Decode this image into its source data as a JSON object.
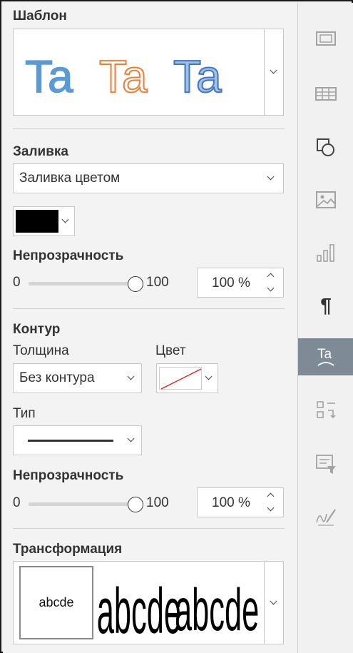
{
  "template": {
    "heading": "Шаблон",
    "samples": [
      {
        "text": "Ta",
        "fill": "#5b9bd5",
        "outline": "#5b9bd5"
      },
      {
        "text": "Ta",
        "fill": "#ffffff",
        "outline": "#ed7d31"
      },
      {
        "text": "Ta",
        "fill": "#9dc3e6",
        "outline": "#4472c4"
      }
    ]
  },
  "fill": {
    "heading": "Заливка",
    "type_value": "Заливка цветом",
    "color": "#000000",
    "opacity_label": "Непрозрачность",
    "min": "0",
    "max": "100",
    "level": 1.0,
    "value": "100 %"
  },
  "contour": {
    "heading": "Контур",
    "thickness_label": "Толщина",
    "thickness_value": "Без контура",
    "color_label": "Цвет",
    "type_label": "Тип",
    "opacity_label": "Непрозрачность",
    "min": "0",
    "max": "100",
    "level": 1.0,
    "value": "100 %"
  },
  "transform": {
    "heading": "Трансформация",
    "samples": [
      "abcde",
      "abcde",
      "abcde"
    ]
  },
  "sidebar": {
    "active_color": "#7e8a96",
    "icons": [
      "slide-settings-icon",
      "table-settings-icon",
      "shape-settings-icon",
      "image-settings-icon",
      "chart-settings-icon",
      "paragraph-settings-icon",
      "text-art-settings-icon",
      "form-settings-icon",
      "mail-merge-icon",
      "signature-settings-icon"
    ]
  }
}
